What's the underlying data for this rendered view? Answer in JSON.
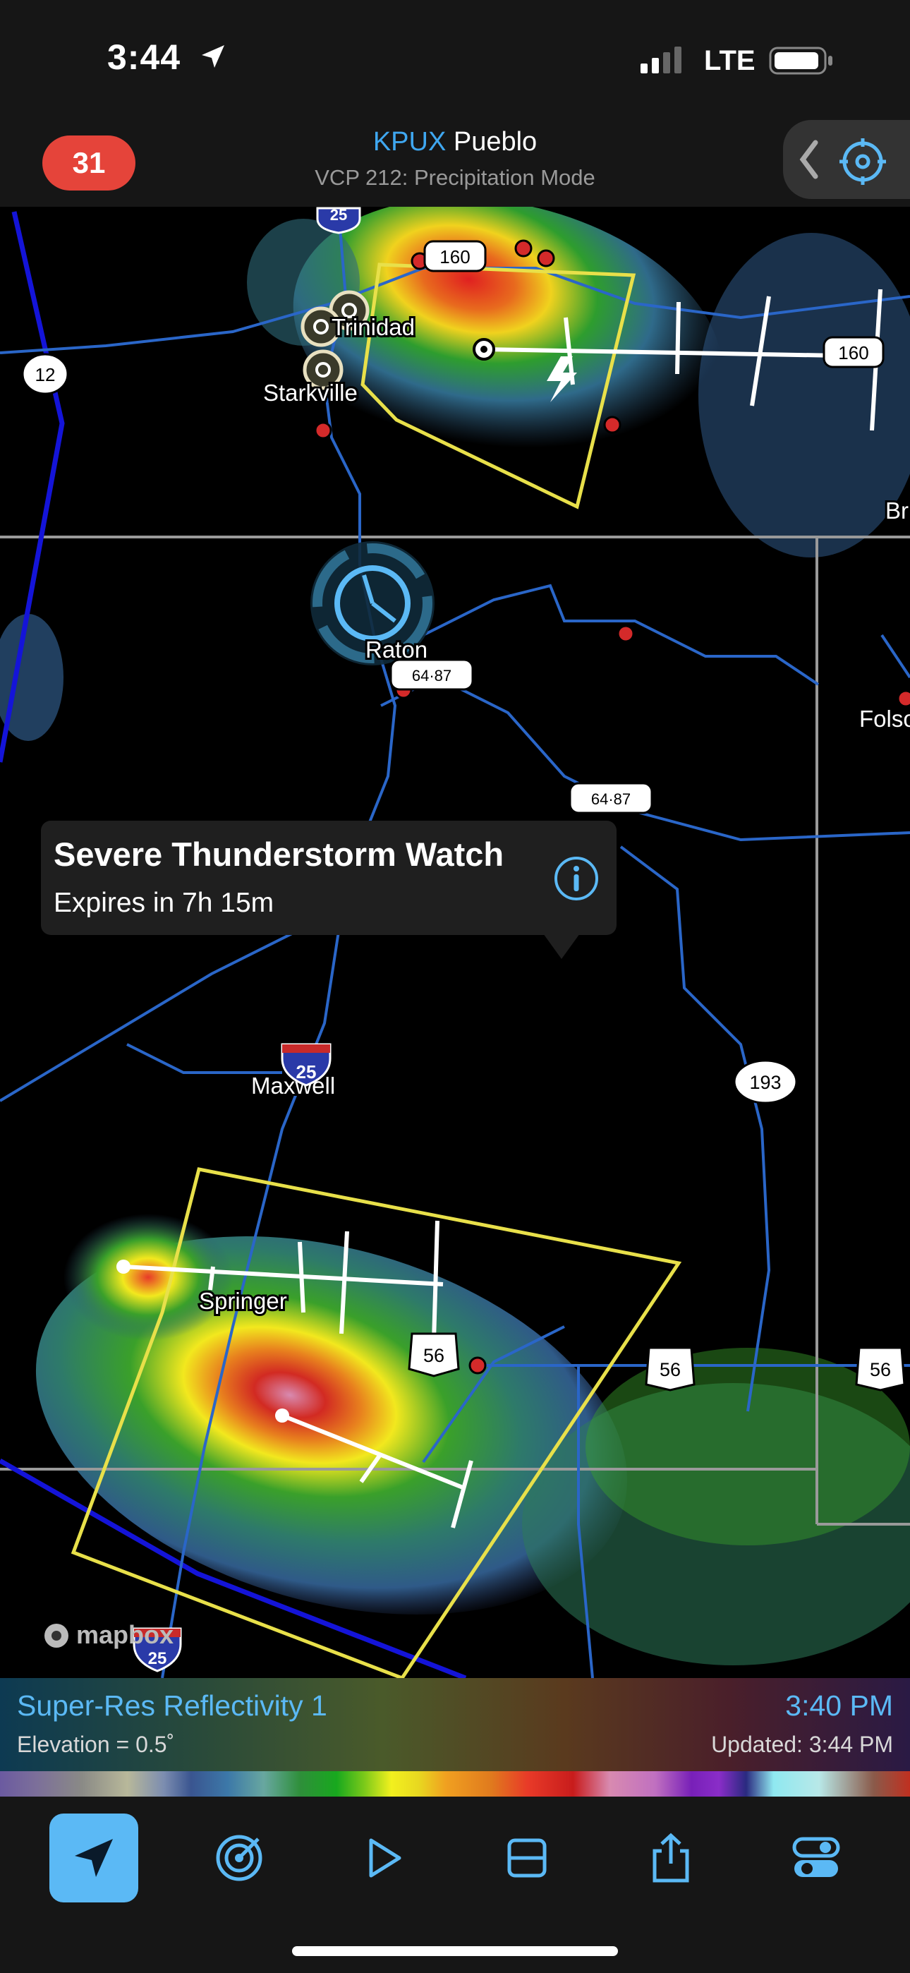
{
  "status_bar": {
    "time": "3:44",
    "network": "LTE"
  },
  "header": {
    "alert_count": "31",
    "site_code": "KPUX",
    "site_name": "Pueblo",
    "vcp": "VCP 212: Precipitation Mode"
  },
  "map": {
    "towns": {
      "trinidad": "Trinidad",
      "starkville": "Starkville",
      "raton": "Raton",
      "folsom": "Folsom",
      "maxwell": "Maxwell",
      "springer": "Springer",
      "br": "Br"
    },
    "shields": {
      "i25_a": "25",
      "i25_b": "25",
      "i25_c": "25",
      "us160_a": "160",
      "us160_b": "160",
      "us12": "12",
      "us6487_a": "64·87",
      "us6487_b": "64·87",
      "nm193": "193",
      "us56_a": "56",
      "us56_b": "56",
      "us56_c": "56"
    },
    "attribution": "mapbox"
  },
  "watch_popup": {
    "title": "Severe Thunderstorm Watch",
    "expires": "Expires in 7h 15m"
  },
  "product": {
    "name": "Super-Res Reflectivity 1",
    "elevation": "Elevation = 0.5˚",
    "scan_time": "3:40 PM",
    "updated": "Updated: 3:44 PM"
  },
  "colors": {
    "accent": "#5bb9f5",
    "badge": "#e5443a",
    "warning_polygon": "#e8e04a"
  },
  "toolbar": [
    "location-arrow-icon",
    "radar-target-icon",
    "play-icon",
    "layout-icon",
    "share-icon",
    "settings-toggle-icon"
  ]
}
